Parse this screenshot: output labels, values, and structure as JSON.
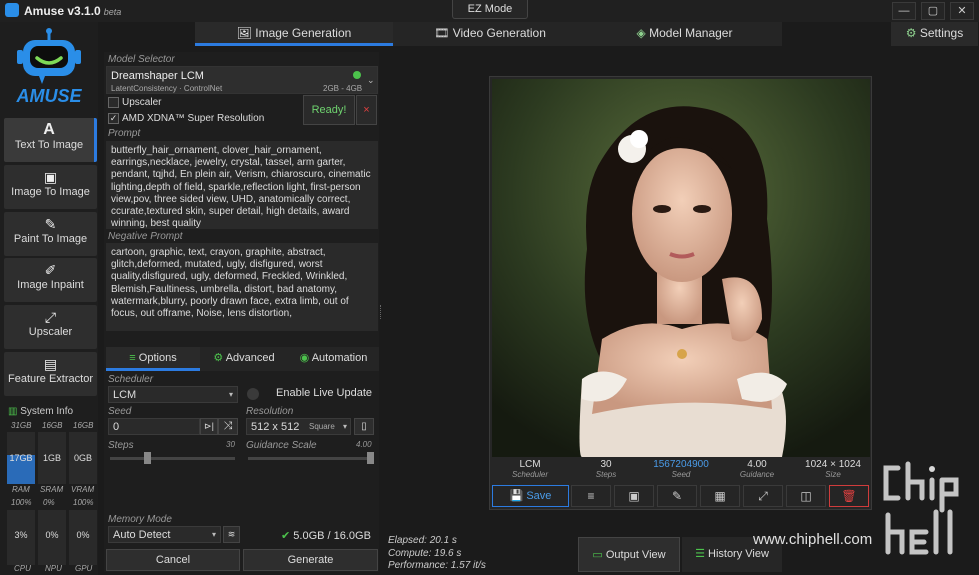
{
  "app": {
    "name": "Amuse v3.1.0",
    "beta": "beta",
    "ez_mode": "EZ Mode",
    "logo_text": "AMUSE"
  },
  "window": {
    "minimize": "—",
    "maximize": "▢",
    "close": "✕"
  },
  "tabs": [
    {
      "label": "Image Generation",
      "icon": "image-icon"
    },
    {
      "label": "Video Generation",
      "icon": "film-icon"
    },
    {
      "label": "Model Manager",
      "icon": "layers-icon"
    }
  ],
  "settings": {
    "label": "Settings",
    "icon": "gear-icon"
  },
  "sidebar": {
    "items": [
      {
        "label": "Text To Image",
        "icon": "A"
      },
      {
        "label": "Image To Image",
        "icon": "🖼"
      },
      {
        "label": "Paint To Image",
        "icon": "🖌"
      },
      {
        "label": "Image Inpaint",
        "icon": "✎"
      },
      {
        "label": "Upscaler",
        "icon": "⤢"
      },
      {
        "label": "Feature Extractor",
        "icon": "🖼"
      }
    ],
    "system_info": {
      "title": "System Info",
      "ram": {
        "label": "RAM",
        "total": "31GB",
        "used": "17GB",
        "pct": "100%",
        "level": 0.55
      },
      "sram": {
        "label": "SRAM",
        "total": "16GB",
        "used": "1GB",
        "pct": "0%"
      },
      "vram": {
        "label": "VRAM",
        "total": "16GB",
        "used": "0GB",
        "pct": "100%"
      },
      "cpu": {
        "label": "CPU",
        "value": "3%"
      },
      "npu": {
        "label": "NPU",
        "value": "0%"
      },
      "gpu": {
        "label": "GPU",
        "value": "0%"
      }
    }
  },
  "model": {
    "label": "Model Selector",
    "name": "Dreamshaper LCM",
    "sub": "LatentConsistency · ControlNet",
    "size": "2GB - 4GB",
    "status_color": "#4cc24c"
  },
  "options": {
    "upscaler": "Upscaler",
    "super_res": "AMD XDNA™ Super Resolution",
    "ready": "Ready!",
    "close": "×"
  },
  "prompt": {
    "label": "Prompt",
    "text": "butterfly_hair_ornament, clover_hair_ornament, earrings,necklace, jewelry, crystal, tassel, arm garter, pendant, tqjhd, En plein air, Verism, chiaroscuro, cinematic lighting,depth of field, sparkle,reflection light, first-person view,pov, three sided view, UHD, anatomically correct, ccurate,textured skin, super detail, high details, award winning, best quality"
  },
  "negative": {
    "label": "Negative Prompt",
    "text": "cartoon, graphic, text, crayon, graphite, abstract, glitch,deformed, mutated, ugly, disfigured, worst quality,disfigured, ugly, deformed, Freckled, Wrinkled, Blemish,Faultiness, umbrella, distort, bad anatomy, watermark,blurry, poorly drawn face, extra limb, out of focus, out offrame, Noise, lens distortion,"
  },
  "subtabs": [
    {
      "label": "Options",
      "icon": "sliders-icon"
    },
    {
      "label": "Advanced",
      "icon": "gears-icon"
    },
    {
      "label": "Automation",
      "icon": "robot-icon"
    }
  ],
  "scheduler": {
    "label": "Scheduler",
    "value": "LCM",
    "live": "Enable Live Update"
  },
  "seed": {
    "label": "Seed",
    "value": "0"
  },
  "resolution": {
    "label": "Resolution",
    "value": "512 x 512",
    "aspect": "Square"
  },
  "steps": {
    "label": "Steps",
    "value": "30",
    "level": 0.3
  },
  "guidance": {
    "label": "Guidance Scale",
    "value": "4.00",
    "level": 1.0
  },
  "memory": {
    "label": "Memory Mode",
    "value": "Auto Detect",
    "usage": "5.0GB / 16.0GB"
  },
  "actions": {
    "cancel": "Cancel",
    "generate": "Generate"
  },
  "result": {
    "scheduler": {
      "value": "LCM",
      "label": "Scheduler"
    },
    "steps": {
      "value": "30",
      "label": "Steps"
    },
    "seed": {
      "value": "1567204900",
      "label": "Seed"
    },
    "guidance": {
      "value": "4.00",
      "label": "Guidance"
    },
    "size": {
      "value": "1024 × 1024",
      "label": "Size"
    },
    "save": "Save"
  },
  "stats": {
    "elapsed": "Elapsed: 20.1 s",
    "compute": "Compute: 19.6 s",
    "performance": "Performance: 1.57 it/s"
  },
  "views": {
    "output": "Output View",
    "history": "History View"
  },
  "watermark": {
    "url": "www.chiphell.com",
    "logo": "chip hell"
  }
}
